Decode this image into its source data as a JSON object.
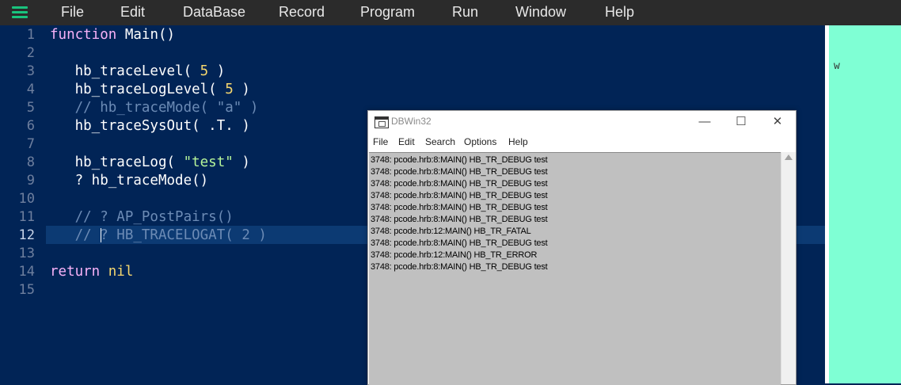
{
  "menubar": {
    "items": [
      "File",
      "Edit",
      "DataBase",
      "Record",
      "Program",
      "Run",
      "Window",
      "Help"
    ],
    "accent": "#19c37d"
  },
  "editor": {
    "line_numbers": [
      "1",
      "2",
      "3",
      "4",
      "5",
      "6",
      "7",
      "8",
      "9",
      "10",
      "11",
      "12",
      "13",
      "14",
      "15"
    ],
    "current_line": 12,
    "lines": [
      [
        {
          "t": "function",
          "c": "kw"
        },
        {
          "t": " Main()",
          "c": ""
        }
      ],
      [],
      [
        {
          "t": "   hb_traceLevel( ",
          "c": ""
        },
        {
          "t": "5",
          "c": "num"
        },
        {
          "t": " )",
          "c": ""
        }
      ],
      [
        {
          "t": "   hb_traceLogLevel( ",
          "c": ""
        },
        {
          "t": "5",
          "c": "num"
        },
        {
          "t": " )",
          "c": ""
        }
      ],
      [
        {
          "t": "   // hb_traceMode( \"a\" )",
          "c": "cm"
        }
      ],
      [
        {
          "t": "   hb_traceSysOut( .T. )",
          "c": ""
        }
      ],
      [],
      [
        {
          "t": "   hb_traceLog( ",
          "c": ""
        },
        {
          "t": "\"test\"",
          "c": "str"
        },
        {
          "t": " )",
          "c": ""
        }
      ],
      [
        {
          "t": "   ? hb_traceMode()",
          "c": ""
        }
      ],
      [],
      [
        {
          "t": "   // ? AP_PostPairs()",
          "c": "cm"
        }
      ],
      [
        {
          "t": "   // ? HB_TRACELOGAT( 2 )",
          "c": "cm"
        }
      ],
      [],
      [
        {
          "t": "return",
          "c": "kw"
        },
        {
          "t": " ",
          "c": ""
        },
        {
          "t": "nil",
          "c": "num"
        }
      ],
      []
    ]
  },
  "right_panel": {
    "text": "w",
    "background": "#7fffd4"
  },
  "dbwin": {
    "title": "DBWin32",
    "minimize": "—",
    "maximize": "☐",
    "close": "✕",
    "menu": [
      "File",
      "Edit",
      "Search",
      "Options",
      "Help"
    ],
    "log": [
      "3748: pcode.hrb:8:MAIN() HB_TR_DEBUG test",
      "3748: pcode.hrb:8:MAIN() HB_TR_DEBUG test",
      "3748: pcode.hrb:8:MAIN() HB_TR_DEBUG test",
      "3748: pcode.hrb:8:MAIN() HB_TR_DEBUG test",
      "3748: pcode.hrb:8:MAIN() HB_TR_DEBUG test",
      "3748: pcode.hrb:8:MAIN() HB_TR_DEBUG test",
      "3748: pcode.hrb:12:MAIN() HB_TR_FATAL",
      "3748: pcode.hrb:8:MAIN() HB_TR_DEBUG test",
      "3748: pcode.hrb:12:MAIN() HB_TR_ERROR",
      "3748: pcode.hrb:8:MAIN() HB_TR_DEBUG test"
    ]
  }
}
